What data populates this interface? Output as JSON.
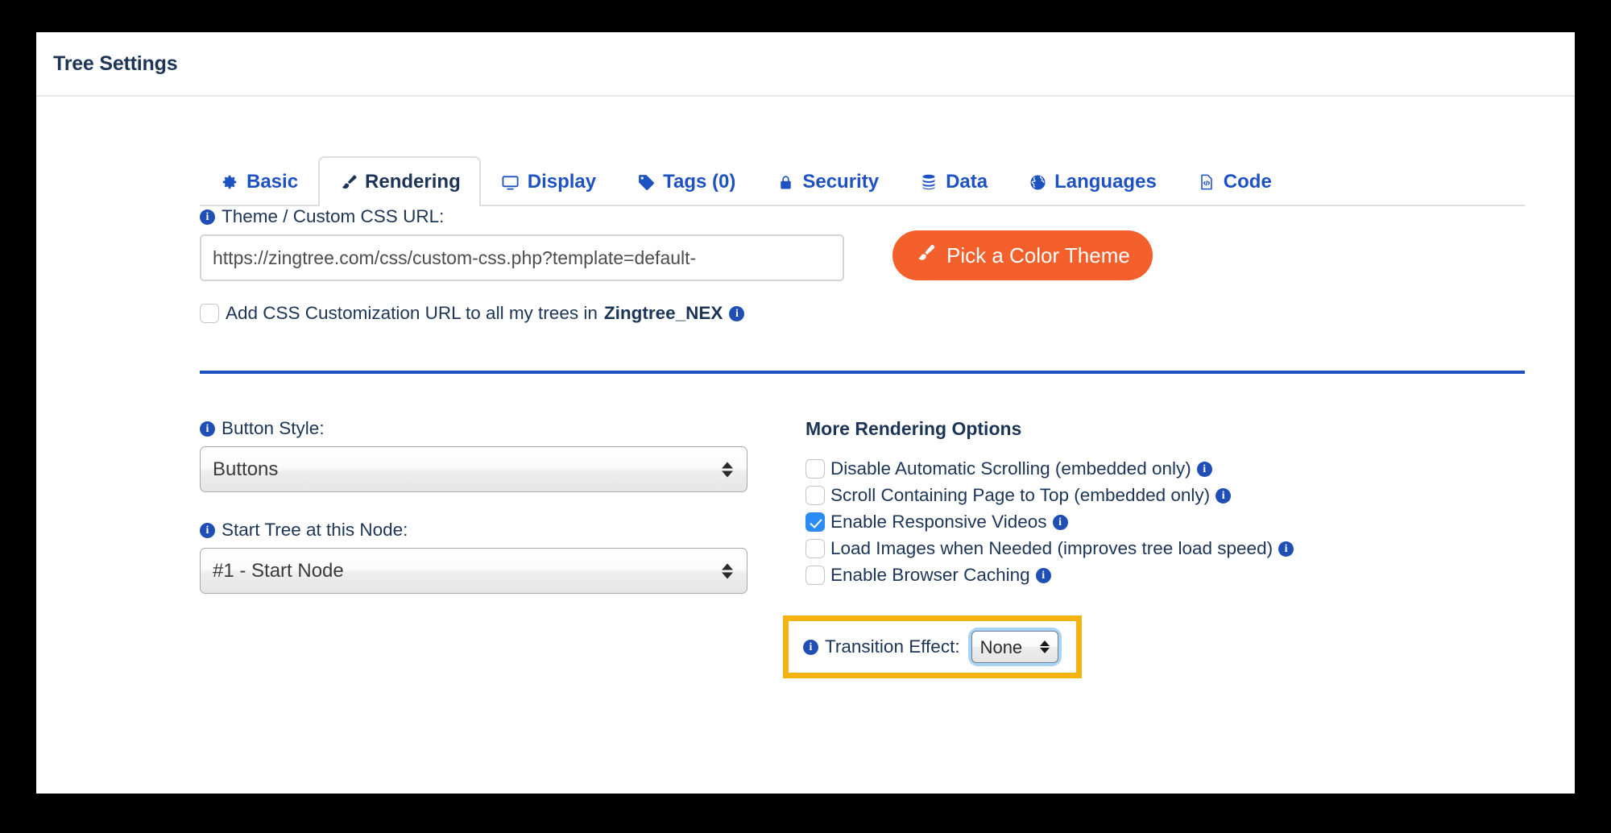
{
  "panel": {
    "title": "Tree Settings"
  },
  "tabs": [
    {
      "label": "Basic",
      "icon": "gear-icon",
      "active": false
    },
    {
      "label": "Rendering",
      "icon": "brush-icon",
      "active": true
    },
    {
      "label": "Display",
      "icon": "monitor-icon",
      "active": false
    },
    {
      "label": "Tags (0)",
      "icon": "tag-icon",
      "active": false
    },
    {
      "label": "Security",
      "icon": "lock-icon",
      "active": false
    },
    {
      "label": "Data",
      "icon": "database-icon",
      "active": false
    },
    {
      "label": "Languages",
      "icon": "globe-icon",
      "active": false
    },
    {
      "label": "Code",
      "icon": "code-file-icon",
      "active": false
    }
  ],
  "theme": {
    "label": "Theme / Custom CSS URL:",
    "info_icon": "info-icon",
    "url_value": "https://zingtree.com/css/custom-css.php?template=default-",
    "url_placeholder": "",
    "button_label": "Pick a Color Theme",
    "button_icon": "brush-icon",
    "button_color": "#f4602b"
  },
  "css_customization": {
    "text_before": "Add CSS Customization URL to all my trees in",
    "account_name": "Zingtree_NEX",
    "checked": false,
    "info_icon": "info-icon"
  },
  "button_style": {
    "label": "Button Style:",
    "value": "Buttons",
    "options": [
      "Buttons"
    ]
  },
  "start_node": {
    "label": "Start Tree at this Node:",
    "value": "#1 - Start Node",
    "options": [
      "#1 - Start Node"
    ]
  },
  "more_rendering": {
    "title": "More Rendering Options",
    "options": [
      {
        "label": "Disable Automatic Scrolling (embedded only)",
        "checked": false
      },
      {
        "label": "Scroll Containing Page to Top (embedded only)",
        "checked": false
      },
      {
        "label": "Enable Responsive Videos",
        "checked": true
      },
      {
        "label": "Load Images when Needed (improves tree load speed)",
        "checked": false
      },
      {
        "label": "Enable Browser Caching",
        "checked": false
      }
    ]
  },
  "transition_effect": {
    "label": "Transition Effect:",
    "value": "None",
    "options": [
      "None"
    ],
    "highlight_color": "#f5b312",
    "focused": true
  },
  "colors": {
    "tab_link": "#1e52c2",
    "heading": "#1c3557",
    "accent_orange": "#f4602b",
    "divider_blue": "#1e52c2",
    "checkbox_checked": "#2b8cf5",
    "highlight_yellow": "#f5b312"
  }
}
